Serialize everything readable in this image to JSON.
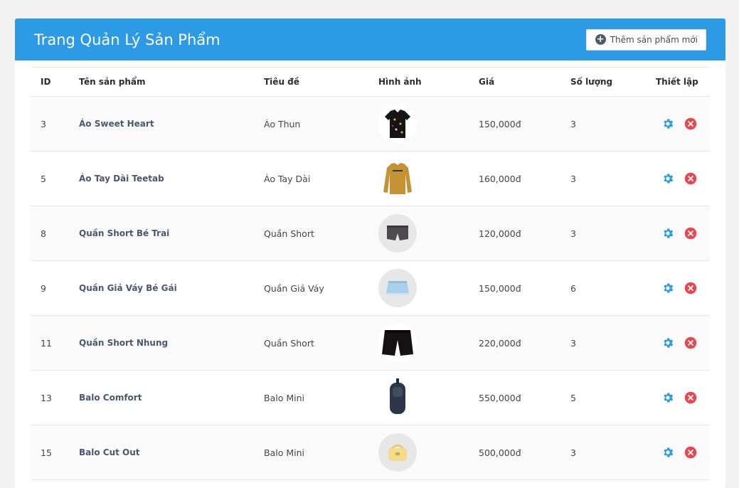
{
  "header": {
    "title": "Trang Quản Lý Sản Phẩm",
    "add_button_label": "Thêm sản phẩm mới"
  },
  "table": {
    "columns": [
      "ID",
      "Tên sản phẩm",
      "Tiêu đề",
      "Hình ảnh",
      "Giá",
      "Số lượng",
      "Thiết lập"
    ],
    "rows": [
      {
        "id": "3",
        "name": "Áo Sweet Heart",
        "title": "Áo Thun",
        "image": "black-shirt",
        "price": "150,000đ",
        "qty": "3"
      },
      {
        "id": "5",
        "name": "Áo Tay Dài Teetab",
        "title": "Áo Tay Dài",
        "image": "long-sleeve",
        "price": "160,000đ",
        "qty": "3"
      },
      {
        "id": "8",
        "name": "Quần Short Bé Trai",
        "title": "Quần Short",
        "image": "grey-shorts",
        "price": "120,000đ",
        "qty": "3"
      },
      {
        "id": "9",
        "name": "Quần Giả Váy Bé Gái",
        "title": "Quần Giả Váy",
        "image": "denim-skirt",
        "price": "150,000đ",
        "qty": "6"
      },
      {
        "id": "11",
        "name": "Quần Short Nhung",
        "title": "Quần Short",
        "image": "black-shorts",
        "price": "220,000đ",
        "qty": "3"
      },
      {
        "id": "13",
        "name": "Balo Comfort",
        "title": "Balo Mini",
        "image": "sling-bag",
        "price": "550,000đ",
        "qty": "5"
      },
      {
        "id": "15",
        "name": "Balo Cut Out",
        "title": "Balo Mini",
        "image": "yellow-bag",
        "price": "500,000đ",
        "qty": "3"
      }
    ]
  },
  "icons": {
    "settings": "gear-icon",
    "delete": "close-circle-icon",
    "add": "plus-circle-icon"
  },
  "colors": {
    "header_bg": "#2d9ae5",
    "gear": "#2d9ae5",
    "delete": "#e8474f"
  }
}
